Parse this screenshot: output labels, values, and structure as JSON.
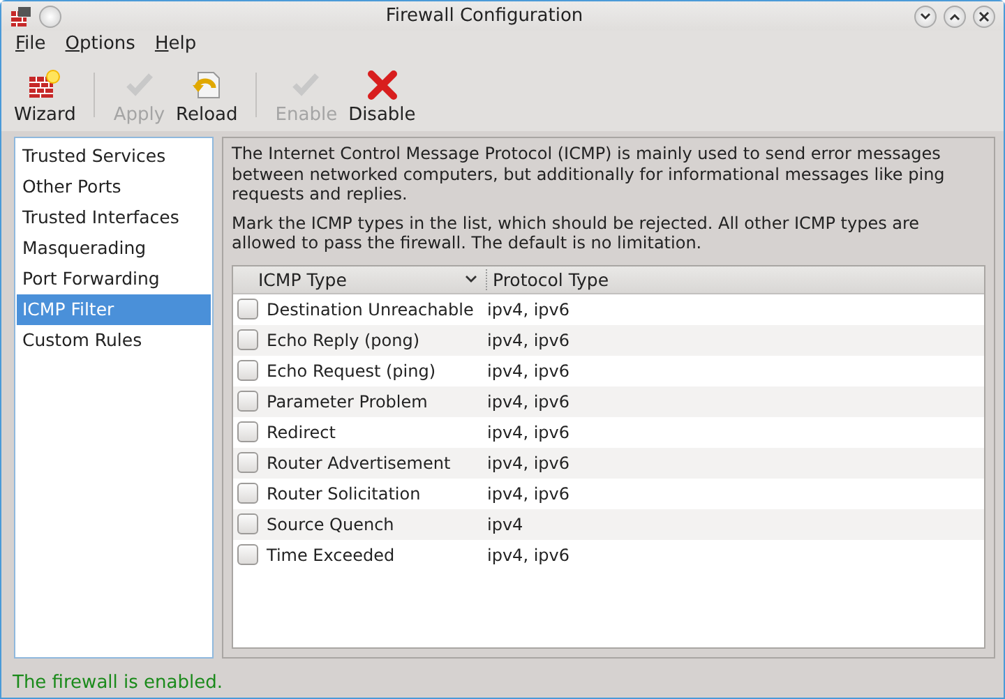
{
  "window": {
    "title": "Firewall Configuration"
  },
  "menu": [
    "File",
    "Options",
    "Help"
  ],
  "toolbar": [
    {
      "label": "Wizard",
      "kind": "wizard",
      "disabled": false
    },
    {
      "label": "Apply",
      "kind": "check",
      "disabled": true
    },
    {
      "label": "Reload",
      "kind": "reload",
      "disabled": false
    },
    {
      "label": "Enable",
      "kind": "check",
      "disabled": true
    },
    {
      "label": "Disable",
      "kind": "cross",
      "disabled": false
    }
  ],
  "sidebar": {
    "items": [
      {
        "label": "Trusted Services",
        "selected": false
      },
      {
        "label": "Other Ports",
        "selected": false
      },
      {
        "label": "Trusted Interfaces",
        "selected": false
      },
      {
        "label": "Masquerading",
        "selected": false
      },
      {
        "label": "Port Forwarding",
        "selected": false
      },
      {
        "label": "ICMP Filter",
        "selected": true
      },
      {
        "label": "Custom Rules",
        "selected": false
      }
    ]
  },
  "description": [
    "The Internet Control Message Protocol (ICMP) is mainly used to send error messages between networked computers, but additionally for informational messages like ping requests and replies.",
    "Mark the ICMP types in the list, which should be rejected. All other ICMP types are allowed to pass the firewall. The default is no limitation."
  ],
  "table": {
    "columns": [
      "ICMP Type",
      "Protocol Type"
    ],
    "rows": [
      {
        "name": "Destination Unreachable",
        "protocol": "ipv4, ipv6",
        "checked": false
      },
      {
        "name": "Echo Reply (pong)",
        "protocol": "ipv4, ipv6",
        "checked": false
      },
      {
        "name": "Echo Request (ping)",
        "protocol": "ipv4, ipv6",
        "checked": false
      },
      {
        "name": "Parameter Problem",
        "protocol": "ipv4, ipv6",
        "checked": false
      },
      {
        "name": "Redirect",
        "protocol": "ipv4, ipv6",
        "checked": false
      },
      {
        "name": "Router Advertisement",
        "protocol": "ipv4, ipv6",
        "checked": false
      },
      {
        "name": "Router Solicitation",
        "protocol": "ipv4, ipv6",
        "checked": false
      },
      {
        "name": "Source Quench",
        "protocol": "ipv4",
        "checked": false
      },
      {
        "name": "Time Exceeded",
        "protocol": "ipv4, ipv6",
        "checked": false
      }
    ]
  },
  "status_bar": "The firewall is enabled."
}
